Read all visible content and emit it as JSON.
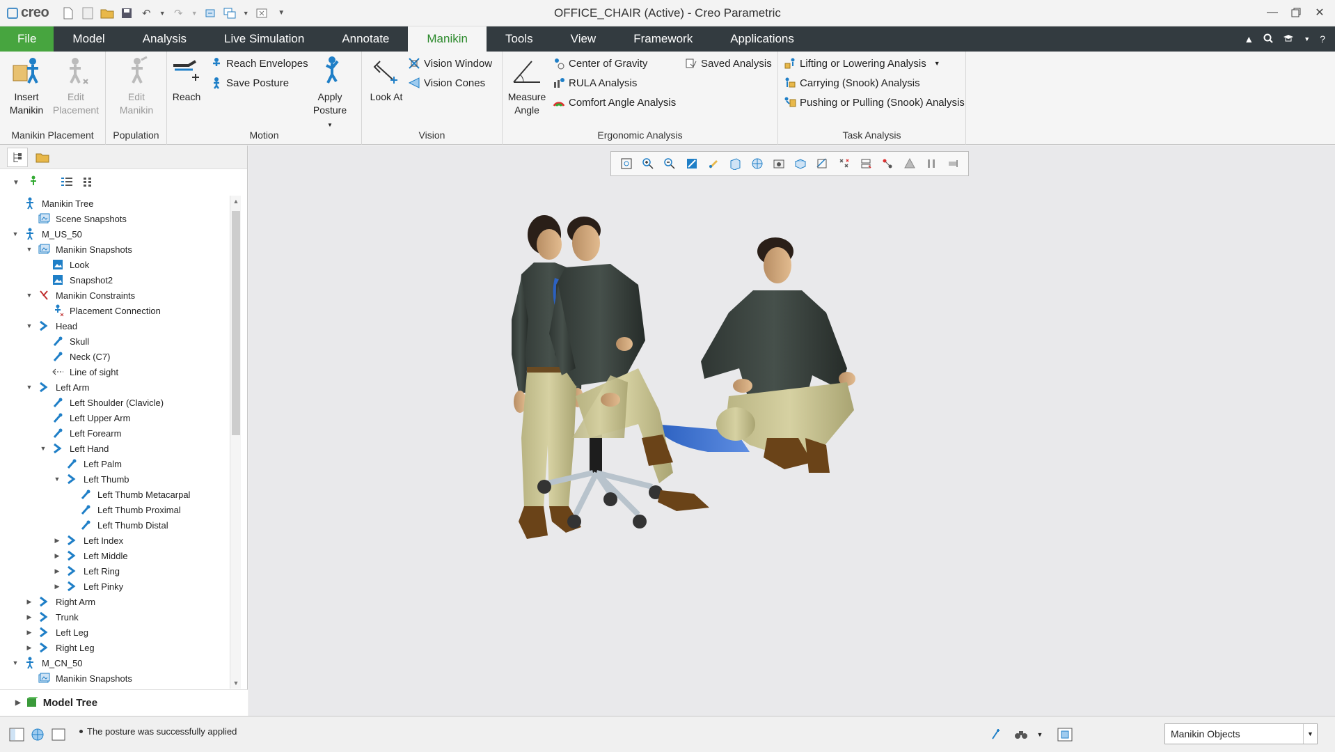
{
  "app": {
    "logo_text": "creo",
    "window_title": "OFFICE_CHAIR (Active) - Creo Parametric"
  },
  "tabs": [
    {
      "label": "File"
    },
    {
      "label": "Model"
    },
    {
      "label": "Analysis"
    },
    {
      "label": "Live Simulation"
    },
    {
      "label": "Annotate"
    },
    {
      "label": "Manikin"
    },
    {
      "label": "Tools"
    },
    {
      "label": "View"
    },
    {
      "label": "Framework"
    },
    {
      "label": "Applications"
    }
  ],
  "ribbon": {
    "manikin_placement": {
      "label": "Manikin Placement",
      "insert": "Insert\nManikin",
      "insert_l1": "Insert",
      "insert_l2": "Manikin",
      "edit_l1": "Edit",
      "edit_l2": "Placement"
    },
    "population": {
      "label": "Population",
      "edit_l1": "Edit",
      "edit_l2": "Manikin"
    },
    "motion": {
      "label": "Motion",
      "reach": "Reach",
      "reach_envelopes": "Reach Envelopes",
      "save_posture": "Save Posture",
      "apply_l1": "Apply",
      "apply_l2": "Posture"
    },
    "vision": {
      "label": "Vision",
      "look_at": "Look At",
      "vision_window": "Vision Window",
      "vision_cones": "Vision Cones"
    },
    "ergonomic": {
      "label": "Ergonomic Analysis",
      "measure_l1": "Measure",
      "measure_l2": "Angle",
      "center_of_gravity": "Center of Gravity",
      "rula": "RULA Analysis",
      "comfort": "Comfort Angle Analysis",
      "saved": "Saved Analysis"
    },
    "task": {
      "label": "Task Analysis",
      "lifting": "Lifting or Lowering Analysis",
      "carrying": "Carrying (Snook) Analysis",
      "pushing": "Pushing or Pulling (Snook) Analysis"
    }
  },
  "tree": [
    {
      "label": "Manikin Tree",
      "depth": 0,
      "twisty": "",
      "icon": "manikin-tree-icon"
    },
    {
      "label": "Scene Snapshots",
      "depth": 1,
      "twisty": "",
      "icon": "snapshot-folder-icon"
    },
    {
      "label": "M_US_50",
      "depth": 0,
      "twisty": "open",
      "icon": "manikin-icon"
    },
    {
      "label": "Manikin Snapshots",
      "depth": 1,
      "twisty": "open",
      "icon": "snapshot-folder-icon"
    },
    {
      "label": "Look",
      "depth": 2,
      "twisty": "",
      "icon": "snapshot-icon"
    },
    {
      "label": "Snapshot2",
      "depth": 2,
      "twisty": "",
      "icon": "snapshot-icon"
    },
    {
      "label": "Manikin Constraints",
      "depth": 1,
      "twisty": "open",
      "icon": "constraints-icon"
    },
    {
      "label": "Placement Connection",
      "depth": 2,
      "twisty": "",
      "icon": "placement-connection-icon"
    },
    {
      "label": "Head",
      "depth": 1,
      "twisty": "open",
      "icon": "segment-icon"
    },
    {
      "label": "Skull",
      "depth": 2,
      "twisty": "",
      "icon": "bone-icon"
    },
    {
      "label": "Neck (C7)",
      "depth": 2,
      "twisty": "",
      "icon": "bone-icon"
    },
    {
      "label": "Line of sight",
      "depth": 2,
      "twisty": "",
      "icon": "line-of-sight-icon"
    },
    {
      "label": "Left Arm",
      "depth": 1,
      "twisty": "open",
      "icon": "segment-icon"
    },
    {
      "label": "Left Shoulder (Clavicle)",
      "depth": 2,
      "twisty": "",
      "icon": "bone-icon"
    },
    {
      "label": "Left Upper Arm",
      "depth": 2,
      "twisty": "",
      "icon": "bone-icon"
    },
    {
      "label": "Left Forearm",
      "depth": 2,
      "twisty": "",
      "icon": "bone-icon"
    },
    {
      "label": "Left Hand",
      "depth": 2,
      "twisty": "open",
      "icon": "segment-icon"
    },
    {
      "label": "Left Palm",
      "depth": 3,
      "twisty": "",
      "icon": "bone-icon"
    },
    {
      "label": "Left Thumb",
      "depth": 3,
      "twisty": "open",
      "icon": "segment-icon"
    },
    {
      "label": "Left Thumb Metacarpal",
      "depth": 4,
      "twisty": "",
      "icon": "bone-icon"
    },
    {
      "label": "Left Thumb Proximal",
      "depth": 4,
      "twisty": "",
      "icon": "bone-icon"
    },
    {
      "label": "Left Thumb Distal",
      "depth": 4,
      "twisty": "",
      "icon": "bone-icon"
    },
    {
      "label": "Left Index",
      "depth": 3,
      "twisty": "closed",
      "icon": "segment-icon"
    },
    {
      "label": "Left Middle",
      "depth": 3,
      "twisty": "closed",
      "icon": "segment-icon"
    },
    {
      "label": "Left Ring",
      "depth": 3,
      "twisty": "closed",
      "icon": "segment-icon"
    },
    {
      "label": "Left Pinky",
      "depth": 3,
      "twisty": "closed",
      "icon": "segment-icon"
    },
    {
      "label": "Right Arm",
      "depth": 1,
      "twisty": "closed",
      "icon": "segment-icon"
    },
    {
      "label": "Trunk",
      "depth": 1,
      "twisty": "closed",
      "icon": "segment-icon"
    },
    {
      "label": "Left Leg",
      "depth": 1,
      "twisty": "closed",
      "icon": "segment-icon"
    },
    {
      "label": "Right Leg",
      "depth": 1,
      "twisty": "closed",
      "icon": "segment-icon"
    },
    {
      "label": "M_CN_50",
      "depth": 0,
      "twisty": "open",
      "icon": "manikin-icon"
    },
    {
      "label": "Manikin Snapshots",
      "depth": 1,
      "twisty": "",
      "icon": "snapshot-folder-icon"
    }
  ],
  "model_tree_label": "Model Tree",
  "status": {
    "message": "The posture was successfully applied",
    "filter_value": "Manikin Objects"
  },
  "colors": {
    "accent_green": "#47a53f",
    "tab_bar": "#333b40",
    "icon_blue": "#1f7fc7"
  }
}
